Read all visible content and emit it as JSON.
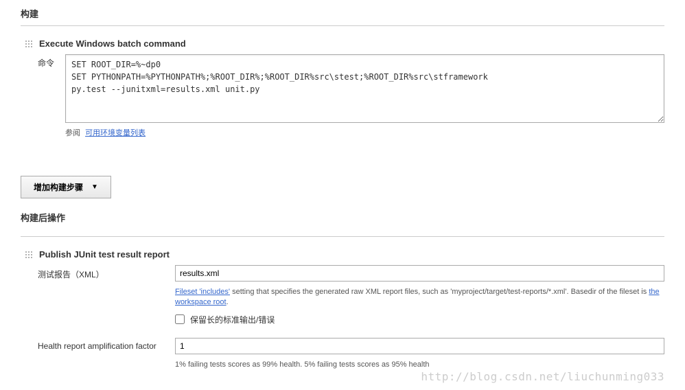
{
  "build": {
    "title": "构建",
    "step": {
      "title": "Execute Windows batch command",
      "command_label": "命令",
      "command_value": "SET ROOT_DIR=%~dp0\nSET PYTHONPATH=%PYTHONPATH%;%ROOT_DIR%;%ROOT_DIR%src\\stest;%ROOT_DIR%src\\stframework\npy.test --junitxml=results.xml unit.py",
      "help_label": "参阅",
      "help_link": "可用环境变量列表"
    },
    "add_step_button": "增加构建步骤"
  },
  "post_build": {
    "title": "构建后操作",
    "step": {
      "title": "Publish JUnit test result report",
      "report_label": "测试报告（XML）",
      "report_value": "results.xml",
      "help_link1": "Fileset 'includes'",
      "help_text1": " setting that specifies the generated raw XML report files, such as 'myproject/target/test-reports/*.xml'. Basedir of the fileset is ",
      "help_link2": "the workspace root",
      "help_text2": ".",
      "checkbox_label": "保留长的标准输出/错误",
      "amplification_label": "Health report amplification factor",
      "amplification_value": "1",
      "amplification_help": "1% failing tests scores as 99% health. 5% failing tests scores as 95% health"
    }
  },
  "watermark": "http://blog.csdn.net/liuchunming033"
}
